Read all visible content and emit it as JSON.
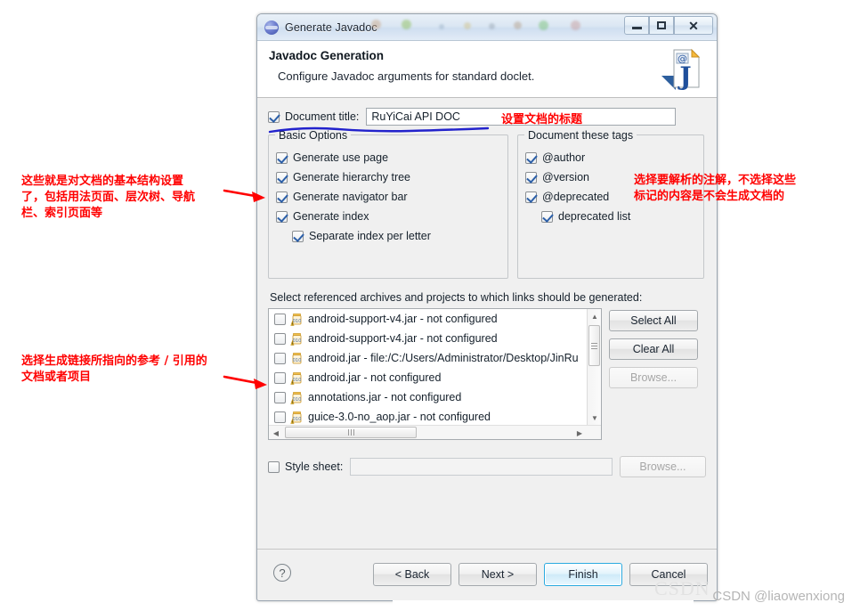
{
  "window": {
    "title": "Generate Javadoc",
    "icon": "eclipse-sphere-icon",
    "minimize_label": "",
    "maximize_label": "",
    "close_label": "✕"
  },
  "header": {
    "title": "Javadoc Generation",
    "subtitle": "Configure Javadoc arguments for standard doclet.",
    "icon": "javadoc-page-icon"
  },
  "document_title": {
    "checkbox_checked": true,
    "label": "Document title:",
    "value": "RuYiCai API DOC",
    "placeholder": ""
  },
  "basic_options": {
    "legend": "Basic Options",
    "items": [
      {
        "label": "Generate use page",
        "checked": true,
        "indent": false
      },
      {
        "label": "Generate hierarchy tree",
        "checked": true,
        "indent": false
      },
      {
        "label": "Generate navigator bar",
        "checked": true,
        "indent": false
      },
      {
        "label": "Generate index",
        "checked": true,
        "indent": false
      },
      {
        "label": "Separate index per letter",
        "checked": true,
        "indent": true
      }
    ]
  },
  "document_tags": {
    "legend": "Document these tags",
    "items": [
      {
        "label": "@author",
        "checked": true,
        "indent": false
      },
      {
        "label": "@version",
        "checked": true,
        "indent": false
      },
      {
        "label": "@deprecated",
        "checked": true,
        "indent": false
      },
      {
        "label": "deprecated list",
        "checked": true,
        "indent": true
      }
    ]
  },
  "references": {
    "label": "Select referenced archives and projects to which links should be generated:",
    "rows": [
      {
        "text": "android-support-v4.jar - not configured",
        "checked": false,
        "icon": "jar-warning-icon"
      },
      {
        "text": "android-support-v4.jar - not configured",
        "checked": false,
        "icon": "jar-warning-icon"
      },
      {
        "text": "android.jar - file:/C:/Users/Administrator/Desktop/JinRu",
        "checked": false,
        "icon": "jar-icon"
      },
      {
        "text": "android.jar - not configured",
        "checked": false,
        "icon": "jar-warning-icon"
      },
      {
        "text": "annotations.jar - not configured",
        "checked": false,
        "icon": "jar-warning-icon"
      },
      {
        "text": "guice-3.0-no_aop.jar - not configured",
        "checked": false,
        "icon": "jar-warning-icon"
      }
    ],
    "buttons": {
      "select_all": "Select All",
      "clear_all": "Clear All",
      "browse": "Browse..."
    }
  },
  "style_sheet": {
    "checkbox_checked": false,
    "label": "Style sheet:",
    "value": "",
    "browse": "Browse..."
  },
  "footer": {
    "help": "?",
    "back": "< Back",
    "next": "Next >",
    "finish": "Finish",
    "cancel": "Cancel"
  },
  "annotations": {
    "basic_options_note": "这些就是对文档的基本结构设置\n了，包括用法页面、层次树、导航\n栏、索引页面等",
    "tags_note": "选择要解析的注解，不选择这些\n标记的内容是不会生成文档的",
    "title_note": "设置文档的标题",
    "references_note": "选择生成链接所指向的参考 / 引用的\n文档或者项目"
  },
  "watermark": {
    "text": "CSDN @liaowenxiong",
    "ghost": "CSDN"
  },
  "colors": {
    "annotation_red": "#ff0000",
    "underline_blue": "#2222cc",
    "dialog_bg": "#f0f0f0",
    "accent_blue": "#2aaae0"
  }
}
